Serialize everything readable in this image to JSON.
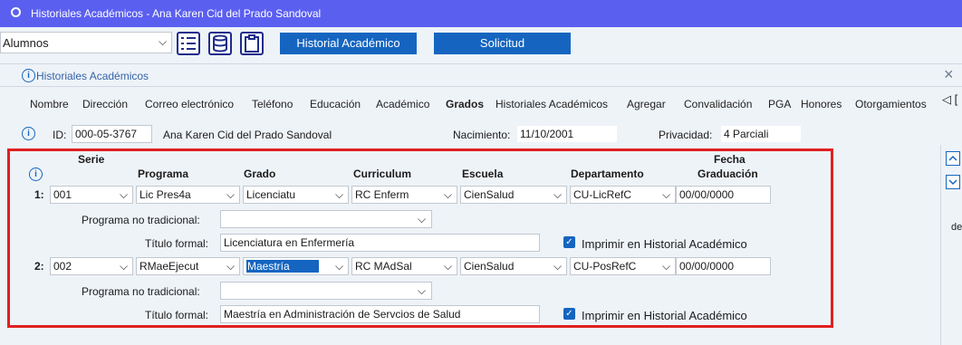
{
  "window": {
    "title": "Historiales Académicos -  Ana Karen Cid del Prado Sandoval"
  },
  "toolbar": {
    "module_select": "Alumnos",
    "historial_button": "Historial Académico",
    "solicitud_button": "Solicitud"
  },
  "panel": {
    "title": "Historiales Académicos",
    "close": "×"
  },
  "tabs": [
    "Nombre",
    "Dirección",
    "Correo electrónico",
    "Teléfono",
    "Educación",
    "Académico",
    "Grados",
    "Historiales Académicos",
    "Agregar",
    "Convalidación",
    "PGA",
    "Honores",
    "Otorgamientos"
  ],
  "tabs_more": "◁ [",
  "student": {
    "id_label": "ID:",
    "id": "000-05-3767",
    "name": "Ana Karen Cid del Prado Sandoval",
    "birth_label": "Nacimiento:",
    "birth": "11/10/2001",
    "privacy_label": "Privacidad:",
    "privacy": "4 Parciali"
  },
  "grid": {
    "headers": {
      "serie": "Serie",
      "programa": "Programa",
      "grado": "Grado",
      "curriculum": "Curriculum",
      "escuela": "Escuela",
      "departamento": "Departamento",
      "fecha1": "Fecha",
      "fecha2": "Graduación"
    },
    "rows": [
      {
        "num": "1:",
        "serie": "001",
        "programa": "Lic Pres4a",
        "grado": "Licenciatu",
        "curriculum": "RC Enferm",
        "escuela": "CienSalud",
        "departamento": "CU-LicRefC",
        "fecha": "00/00/0000",
        "no_trad_label": "Programa no tradicional:",
        "no_trad": "",
        "titulo_label": "Título formal:",
        "titulo": "Licenciatura en Enfermería",
        "imprimir": "Imprimir en Historial Académico"
      },
      {
        "num": "2:",
        "serie": "002",
        "programa": "RMaeEjecut",
        "grado": "Maestría",
        "curriculum": "RC MAdSal",
        "escuela": "CienSalud",
        "departamento": "CU-PosRefC",
        "fecha": "00/00/0000",
        "no_trad_label": "Programa no tradicional:",
        "no_trad": "",
        "titulo_label": "Título formal:",
        "titulo": "Maestría en Administración de Servcios de Salud",
        "imprimir": "Imprimir en Historial Académico"
      }
    ]
  },
  "side_text": "de",
  "icons": {
    "dropdown": "▾",
    "check": "✓",
    "info": "i",
    "scroll_up": "⌃",
    "scroll_down": "⌄"
  }
}
